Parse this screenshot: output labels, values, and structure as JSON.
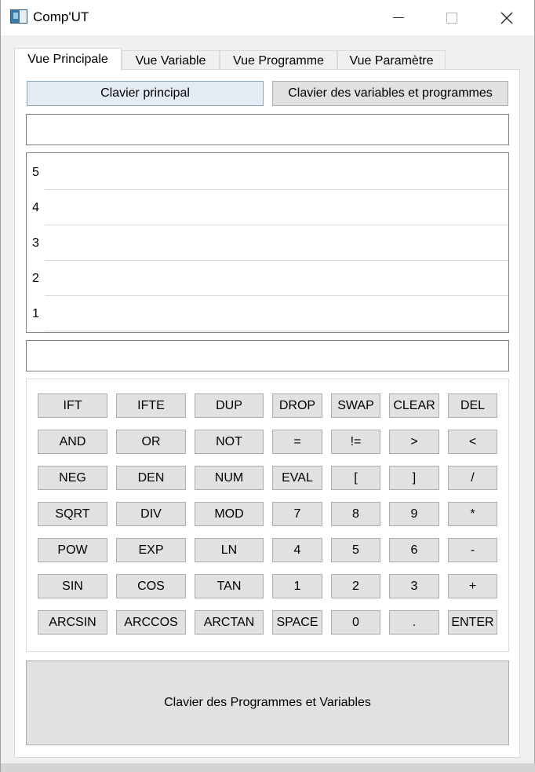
{
  "window": {
    "title": "Comp'UT",
    "minimize_label": "",
    "maximize_label": "",
    "close_label": "✕"
  },
  "tabs": [
    {
      "label": "Vue Principale",
      "active": true
    },
    {
      "label": "Vue Variable",
      "active": false
    },
    {
      "label": "Vue Programme",
      "active": false
    },
    {
      "label": "Vue Paramètre",
      "active": false
    }
  ],
  "keyboard_switch": {
    "main_label": "Clavier principal",
    "vars_label": "Clavier des variables et programmes",
    "selected": "main"
  },
  "message_field": {
    "value": ""
  },
  "stack": {
    "rows": [
      {
        "level": "5",
        "value": ""
      },
      {
        "level": "4",
        "value": ""
      },
      {
        "level": "3",
        "value": ""
      },
      {
        "level": "2",
        "value": ""
      },
      {
        "level": "1",
        "value": ""
      }
    ]
  },
  "command_line": {
    "value": ""
  },
  "keypad": {
    "rows": [
      [
        "IFT",
        "IFTE",
        "DUP",
        "DROP",
        "SWAP",
        "CLEAR",
        "DEL"
      ],
      [
        "AND",
        "OR",
        "NOT",
        "=",
        "!=",
        ">",
        "<"
      ],
      [
        "NEG",
        "DEN",
        "NUM",
        "EVAL",
        "[",
        "]",
        "/"
      ],
      [
        "SQRT",
        "DIV",
        "MOD",
        "7",
        "8",
        "9",
        "*"
      ],
      [
        "POW",
        "EXP",
        "LN",
        "4",
        "5",
        "6",
        "-"
      ],
      [
        "SIN",
        "COS",
        "TAN",
        "1",
        "2",
        "3",
        "+"
      ],
      [
        "ARCSIN",
        "ARCCOS",
        "ARCTAN",
        "SPACE",
        "0",
        ".",
        "ENTER"
      ]
    ]
  },
  "programs_keyboard": {
    "label": "Clavier des Programmes et Variables"
  }
}
